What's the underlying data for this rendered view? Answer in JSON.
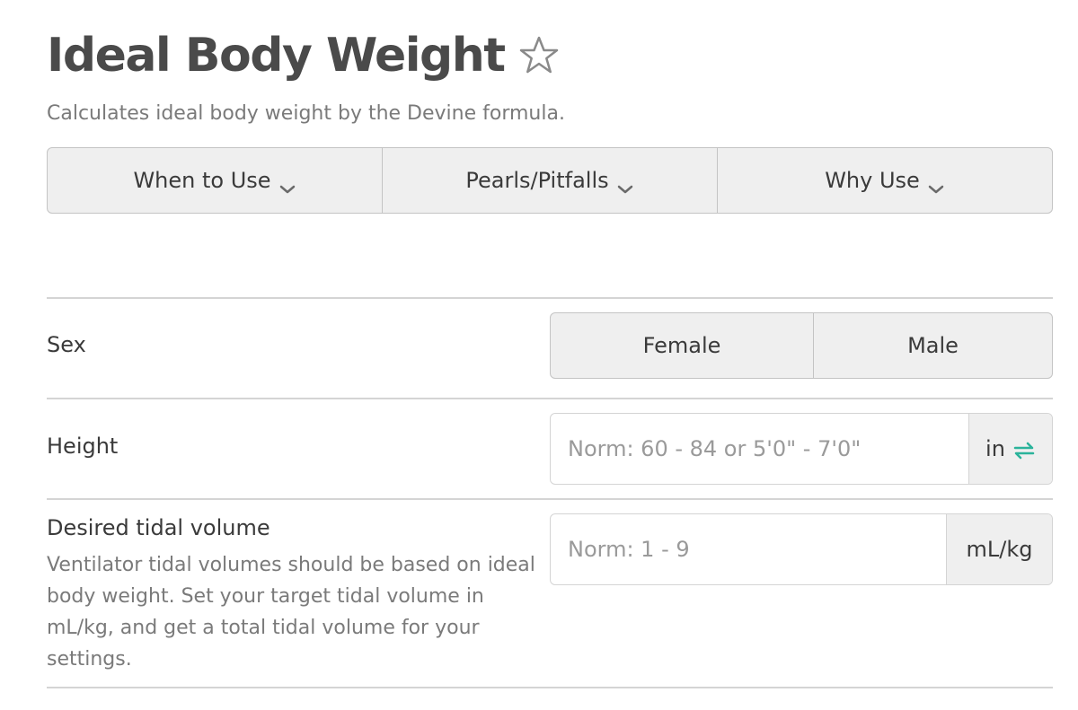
{
  "header": {
    "title": "Ideal Body Weight",
    "subtitle": "Calculates ideal body weight by the Devine formula.",
    "star_icon": "star-outline-icon"
  },
  "tabs": [
    {
      "label": "When to Use",
      "icon": "chevron-down-icon"
    },
    {
      "label": "Pearls/Pitfalls",
      "icon": "chevron-down-icon"
    },
    {
      "label": "Why Use",
      "icon": "chevron-down-icon"
    }
  ],
  "form": {
    "sex": {
      "label": "Sex",
      "options": [
        "Female",
        "Male"
      ]
    },
    "height": {
      "label": "Height",
      "value": "",
      "placeholder": "Norm: 60 - 84 or 5'0\" - 7'0\"",
      "unit": "in",
      "unit_icon": "swap-units-icon"
    },
    "tidal_volume": {
      "label": "Desired tidal volume",
      "description": "Ventilator tidal volumes should be based on ideal body weight. Set your target tidal volume in mL/kg, and get a total tidal volume for your settings.",
      "value": "",
      "placeholder": "Norm: 1 - 9",
      "unit": "mL/kg"
    }
  },
  "colors": {
    "accent": "#2bb39b",
    "border": "#c4c4c4",
    "button_bg": "#efefef",
    "muted_text": "#7a7a7a"
  }
}
